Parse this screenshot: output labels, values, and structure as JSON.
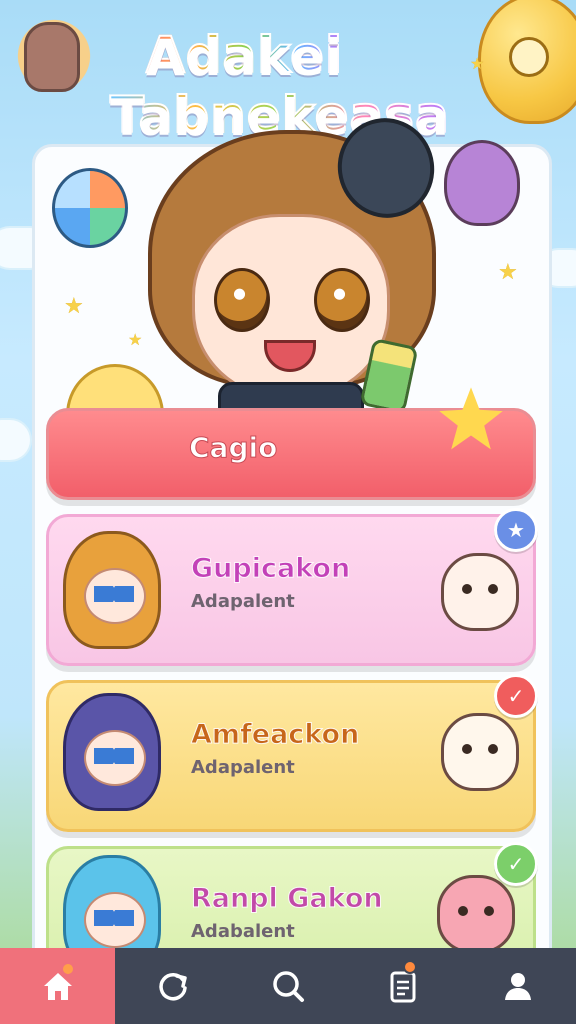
{
  "header": {
    "title_line1": "Adakei",
    "title_line2": "Tabnekeasa"
  },
  "cards": [
    {
      "title": "Cagio",
      "subtitle": "",
      "badge": "star-icon"
    },
    {
      "title": "Gupicakon",
      "subtitle": "Adapalent",
      "badge": "star-icon"
    },
    {
      "title": "Amfeackon",
      "subtitle": "Adapalent",
      "badge": "check-icon"
    },
    {
      "title": "Ranpl Gakon",
      "subtitle": "Adabalent",
      "badge": "check-icon"
    }
  ],
  "nav": {
    "items": [
      {
        "name": "home",
        "icon": "home-icon",
        "active": true
      },
      {
        "name": "refresh",
        "icon": "refresh-icon",
        "active": false
      },
      {
        "name": "search",
        "icon": "search-icon",
        "active": false
      },
      {
        "name": "clipboard",
        "icon": "clipboard-icon",
        "active": false,
        "notification": true
      },
      {
        "name": "profile",
        "icon": "user-icon",
        "active": false
      }
    ]
  },
  "colors": {
    "accent": "#f0717b",
    "nav_bg": "#3f4656",
    "card_pink": "#f8c6e5",
    "card_yellow": "#f8d777",
    "card_green": "#d9f0ad",
    "badge_blue": "#6a8fe6",
    "badge_red": "#f05d5d",
    "badge_green": "#7ccf6a"
  }
}
